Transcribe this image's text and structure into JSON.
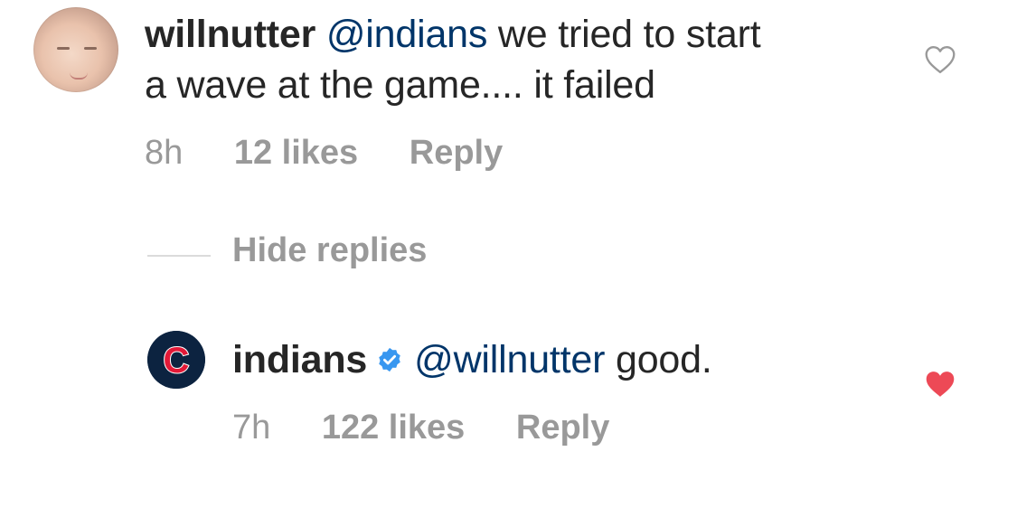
{
  "comments": [
    {
      "username": "willnutter",
      "mention": "@indians",
      "text_line1": " we tried to start",
      "text_line2": "a wave at the game.... it failed",
      "time": "8h",
      "likes": "12 likes",
      "reply_label": "Reply",
      "liked": false,
      "avatar_icon": "user-photo"
    },
    {
      "username": "indians",
      "verified": true,
      "mention": "@willnutter",
      "text": " good.",
      "time": "7h",
      "likes": "122 likes",
      "reply_label": "Reply",
      "liked": true,
      "avatar_icon": "team-logo-c",
      "avatar_letter": "C"
    }
  ],
  "hide_replies_label": "Hide replies",
  "colors": {
    "mention": "#003569",
    "meta": "#999999",
    "like_active": "#ed4956",
    "verified": "#3897f0"
  }
}
